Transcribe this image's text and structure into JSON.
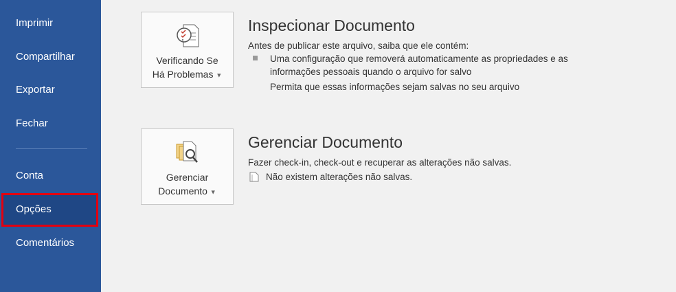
{
  "sidebar": {
    "items": [
      {
        "label": "Imprimir"
      },
      {
        "label": "Compartilhar"
      },
      {
        "label": "Exportar"
      },
      {
        "label": "Fechar"
      },
      {
        "label": "Conta"
      },
      {
        "label": "Opções",
        "selected": true
      },
      {
        "label": "Comentários"
      }
    ]
  },
  "inspect": {
    "button_line1": "Verificando Se",
    "button_line2": "Há Problemas",
    "title": "Inspecionar Documento",
    "description": "Antes de publicar este arquivo, saiba que ele contém:",
    "bullet_line1": "Uma configuração que removerá automaticamente as propriedades e as",
    "bullet_line2": "informações pessoais quando o arquivo for salvo",
    "link": "Permita que essas informações sejam salvas no seu arquivo"
  },
  "manage": {
    "button_line1": "Gerenciar",
    "button_line2": "Documento",
    "title": "Gerenciar Documento",
    "description": "Fazer check-in, check-out e recuperar as alterações não salvas.",
    "status": "Não existem alterações não salvas."
  },
  "colors": {
    "sidebar": "#2b579a",
    "highlight": "#e3000f",
    "link": "#2b6cb0"
  }
}
